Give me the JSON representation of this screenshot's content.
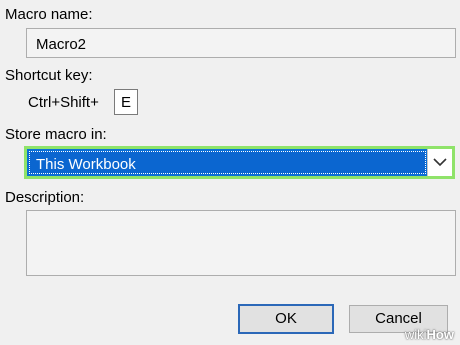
{
  "dialog": {
    "macro_name_label": "Macro name:",
    "macro_name_value": "Macro2",
    "shortcut_key_label": "Shortcut key:",
    "shortcut_prefix": "Ctrl+Shift+",
    "shortcut_key_value": "E",
    "store_macro_label": "Store macro in:",
    "store_macro_value": "This Workbook",
    "description_label": "Description:",
    "description_value": "",
    "ok_label": "OK",
    "cancel_label": "Cancel"
  },
  "colors": {
    "highlight_border": "#8fe36a",
    "selection_bg": "#0b66d0",
    "dialog_bg": "#f0f0f0",
    "default_button_border": "#2b68b8"
  },
  "icons": {
    "dropdown": "chevron-down-icon"
  },
  "watermark": {
    "prefix": "wiki",
    "suffix": "How"
  }
}
